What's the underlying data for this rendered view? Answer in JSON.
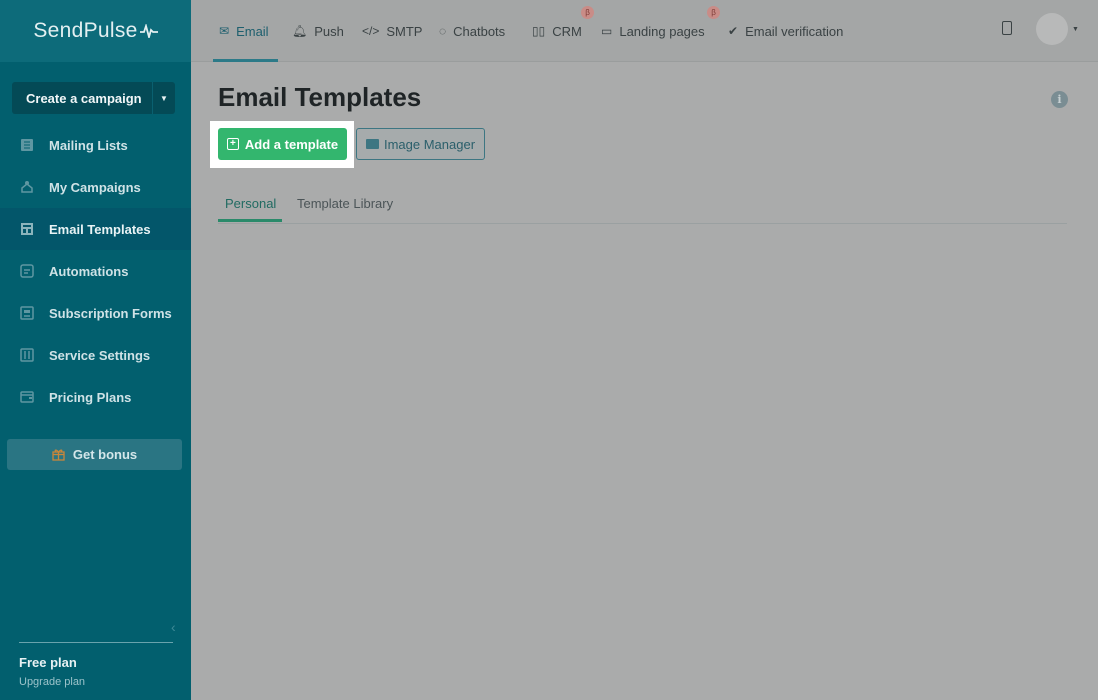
{
  "brand": {
    "name": "SendPulse"
  },
  "sidebar": {
    "create_campaign": "Create a campaign",
    "items": [
      {
        "label": "Mailing Lists",
        "icon": "list-icon"
      },
      {
        "label": "My Campaigns",
        "icon": "campaign-icon"
      },
      {
        "label": "Email Templates",
        "icon": "template-icon",
        "active": true
      },
      {
        "label": "Automations",
        "icon": "automation-icon"
      },
      {
        "label": "Subscription Forms",
        "icon": "form-icon"
      },
      {
        "label": "Service Settings",
        "icon": "settings-icon"
      },
      {
        "label": "Pricing Plans",
        "icon": "wallet-icon"
      }
    ],
    "bonus": "Get bonus",
    "plan": "Free plan",
    "upgrade": "Upgrade plan"
  },
  "topnav": {
    "tabs": [
      {
        "label": "Email",
        "icon": "mail-icon",
        "active": true
      },
      {
        "label": "Push",
        "icon": "bell-icon"
      },
      {
        "label": "SMTP",
        "icon": "code-icon"
      },
      {
        "label": "Chatbots",
        "icon": "chat-icon"
      },
      {
        "label": "CRM",
        "icon": "crm-icon",
        "beta": "β"
      },
      {
        "label": "Landing pages",
        "icon": "landing-icon",
        "beta": "β"
      },
      {
        "label": "Email verification",
        "icon": "check-circle-icon"
      }
    ]
  },
  "main": {
    "title": "Email Templates",
    "add_template": "Add a template",
    "image_manager": "Image Manager",
    "subtabs": [
      "Personal",
      "Template Library"
    ]
  },
  "colors": {
    "sidebar": "#025f6e",
    "accent_green": "#33b66e",
    "overlay": "#aaabab"
  }
}
